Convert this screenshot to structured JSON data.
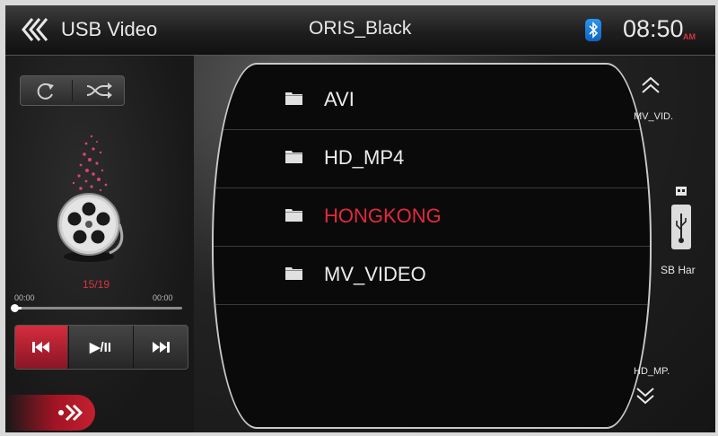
{
  "top_bar": {
    "back_icon": "double-chevron-left-icon",
    "source_label": "USB Video",
    "device_name": "ORIS_Black",
    "bluetooth_icon": "bluetooth-icon",
    "time": "08:50",
    "meridiem": "AM"
  },
  "player": {
    "repeat_icon": "repeat-icon",
    "shuffle_icon": "shuffle-icon",
    "media_icon": "film-reel-icon",
    "track_counter": "15/19",
    "elapsed": "00:00",
    "duration": "00:00",
    "progress": 0.03,
    "controls": {
      "prev_icon": "skip-previous-icon",
      "play_pause_label": "▶/II",
      "next_icon": "skip-next-icon"
    },
    "go_icon": "forward-arrow-icon"
  },
  "browser": {
    "folders": [
      {
        "name": "AVI",
        "active": false
      },
      {
        "name": "HD_MP4",
        "active": false
      },
      {
        "name": "HONGKONG",
        "active": true
      },
      {
        "name": "MV_VIDEO",
        "active": false
      }
    ],
    "up_label": "MV_VID.",
    "device_label": "SB Har",
    "down_label": "HD_MP."
  },
  "colors": {
    "accent_red": "#e3293c",
    "text": "#ececec",
    "bluetooth_blue": "#1f80e0"
  }
}
